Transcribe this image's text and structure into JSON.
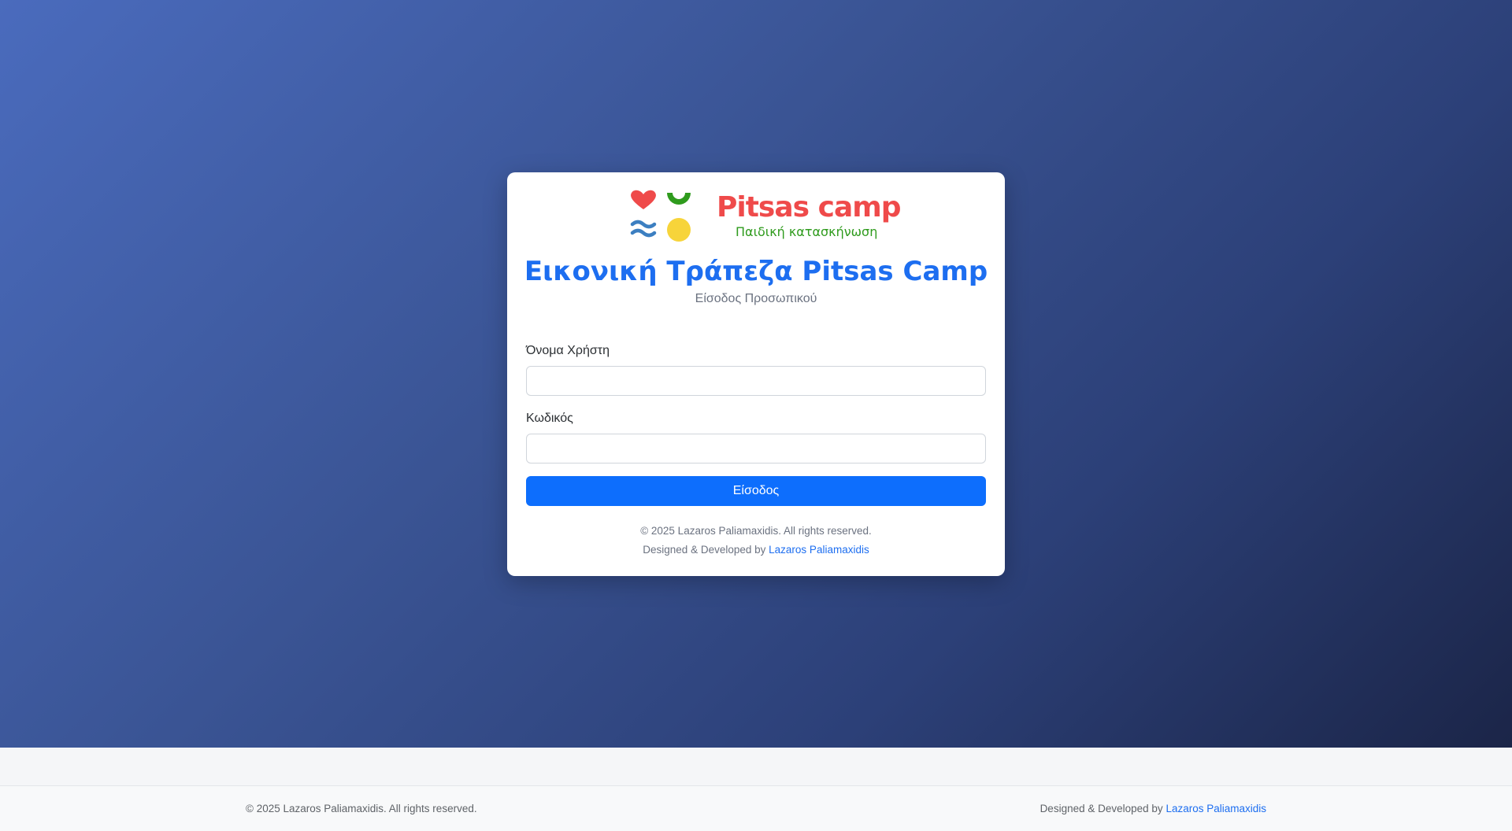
{
  "brand": {
    "name": "Pitsas camp",
    "tagline": "Παιδική κατασκήνωση"
  },
  "login": {
    "title": "Εικονική Τράπεζα Pitsas Camp",
    "subtitle": "Είσοδος Προσωπικού",
    "username_label": "Όνομα Χρήστη",
    "username_value": "",
    "password_label": "Κωδικός",
    "password_value": "",
    "submit_label": "Είσοδος"
  },
  "card_footer": {
    "copyright": "© 2025 Lazaros Paliamaxidis. All rights reserved.",
    "credit_prefix": "Designed & Developed by",
    "credit_link": "Lazaros Paliamaxidis"
  },
  "site_footer": {
    "copyright": "© 2025 Lazaros Paliamaxidis. All rights reserved.",
    "credit_prefix": "Designed & Developed by",
    "credit_link": "Lazaros Paliamaxidis"
  },
  "colors": {
    "primary": "#0d6efd",
    "brand_red": "#ef4a4a",
    "brand_green": "#2f9b1d",
    "brand_blue": "#3c7fc1",
    "brand_yellow": "#f7d43a"
  },
  "icons": {
    "logo_heart": "heart-icon",
    "logo_smile": "smile-arc-icon",
    "logo_waves": "waves-icon",
    "logo_sun": "sun-circle-icon"
  }
}
